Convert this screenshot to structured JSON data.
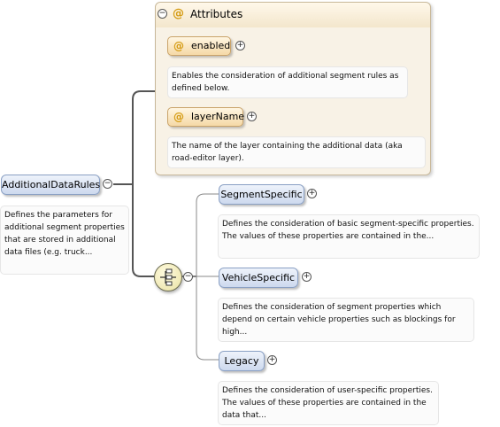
{
  "root": {
    "name": "AdditionalDataRules",
    "doc": "Defines the parameters for additional segment properties that are stored in additional data files (e.g. truck..."
  },
  "attributes_group": {
    "title": "Attributes",
    "items": [
      {
        "name": "enabled",
        "doc": "Enables the consideration of additional segment rules as defined below."
      },
      {
        "name": "layerName",
        "doc": "The name of the layer containing the additional data (aka road-editor layer)."
      }
    ]
  },
  "sequence": {
    "children": [
      {
        "name": "SegmentSpecific",
        "doc": "Defines the consideration of basic segment-specific properties. The values of these properties are contained in the..."
      },
      {
        "name": "VehicleSpecific",
        "doc": "Defines the consideration of segment properties which depend on certain vehicle properties such as blockings for high..."
      },
      {
        "name": "Legacy",
        "doc": "Defines the consideration of user-specific properties. The values of these properties are contained in the data that..."
      }
    ]
  },
  "glyphs": {
    "collapse": "−",
    "expand": "+",
    "attribute": "@"
  },
  "colors": {
    "attribute_fill": "#f5d9a6",
    "element_fill": "#cdd9ee",
    "group_fill": "#f8f2e6",
    "connector": "#555555"
  }
}
